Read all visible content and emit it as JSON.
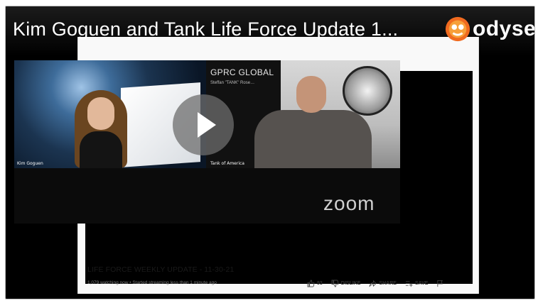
{
  "overlay": {
    "title": "Kim Goguen and Tank Life Force Update 1...",
    "brand_name": "odysee",
    "brand_icon": "odysee-logo"
  },
  "player": {
    "left_pane_label": "Kim Goguen",
    "right_pane_heading": "GPRC GLOBAL",
    "right_pane_subtitle": "Steffan \"TANK\" Rose…",
    "right_pane_label": "Tank of America",
    "zoom_label": "zoom",
    "play_icon": "play-icon"
  },
  "video": {
    "title": "LIFE FORCE WEEKLY UPDATE - 11-30-21",
    "meta": "1,079 watching now • Started streaming less than 1 minute ago",
    "like_count": "93",
    "dislike_label": "DISLIKE",
    "share_label": "SHARE",
    "save_label": "SAVE"
  },
  "colors": {
    "frame_background": "#000000",
    "embed_background": "#f9f9f9",
    "brand_accent": "#f06a1f"
  }
}
